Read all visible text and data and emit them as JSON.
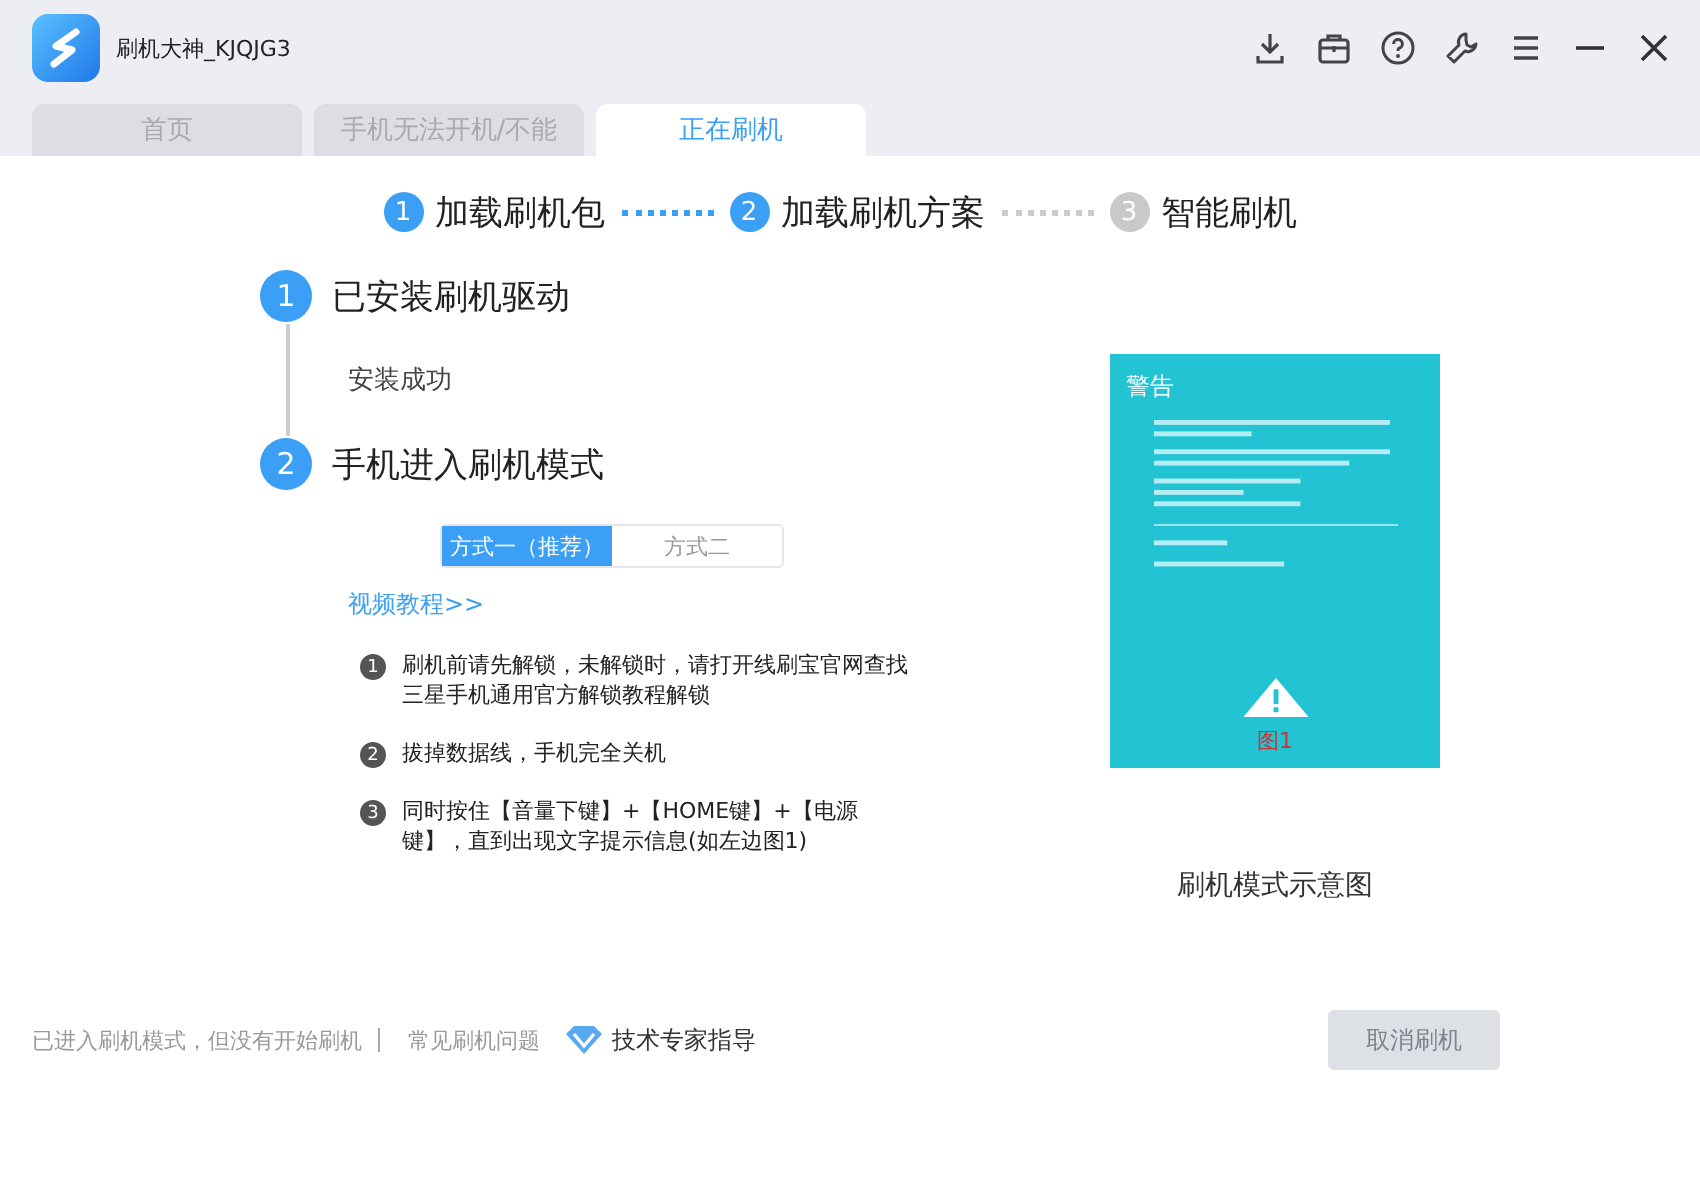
{
  "window": {
    "title": "刷机大神_KJQJG3"
  },
  "toolbar": [
    {
      "kind": "download"
    },
    {
      "kind": "toolbox"
    },
    {
      "kind": "help"
    },
    {
      "kind": "wrench"
    },
    {
      "kind": "menu"
    },
    {
      "kind": "minimize"
    },
    {
      "kind": "close"
    }
  ],
  "tabs": [
    {
      "label": "首页",
      "selected": false
    },
    {
      "label": "手机无法开机/不能",
      "selected": false
    },
    {
      "label": "正在刷机",
      "selected": true
    }
  ],
  "progress_steps": [
    {
      "number": "1",
      "label": "加载刷机包",
      "done": true
    },
    {
      "number": "2",
      "label": "加载刷机方案",
      "done": true
    },
    {
      "number": "3",
      "label": "智能刷机",
      "done": false
    }
  ],
  "stages": [
    {
      "number": "1",
      "title": "已安装刷机驱动",
      "status": "安装成功"
    },
    {
      "number": "2",
      "title": "手机进入刷机模式"
    }
  ],
  "method_tabs": [
    {
      "label": "方式一（推荐）",
      "selected": true
    },
    {
      "label": "方式二",
      "selected": false
    }
  ],
  "video_link": "视频教程>>",
  "instructions": [
    {
      "number": "1",
      "text": "刷机前请先解锁，未解锁时，请打开线刷宝官网查找三星手机通用官方解锁教程解锁"
    },
    {
      "number": "2",
      "text": "拔掉数据线，手机完全关机"
    },
    {
      "number": "3",
      "text": "同时按住【音量下键】+【HOME键】+【电源键】，直到出现文字提示信息(如左边图1)"
    }
  ],
  "preview": {
    "heading": "警告",
    "figure_label": "图1",
    "caption": "刷机模式示意图"
  },
  "footer": {
    "status": "已进入刷机模式，但没有开始刷机",
    "faq_link": "常见刷机问题",
    "expert_link": "技术专家指导",
    "cancel_button": {
      "label": "取消刷机",
      "disabled": true
    }
  }
}
